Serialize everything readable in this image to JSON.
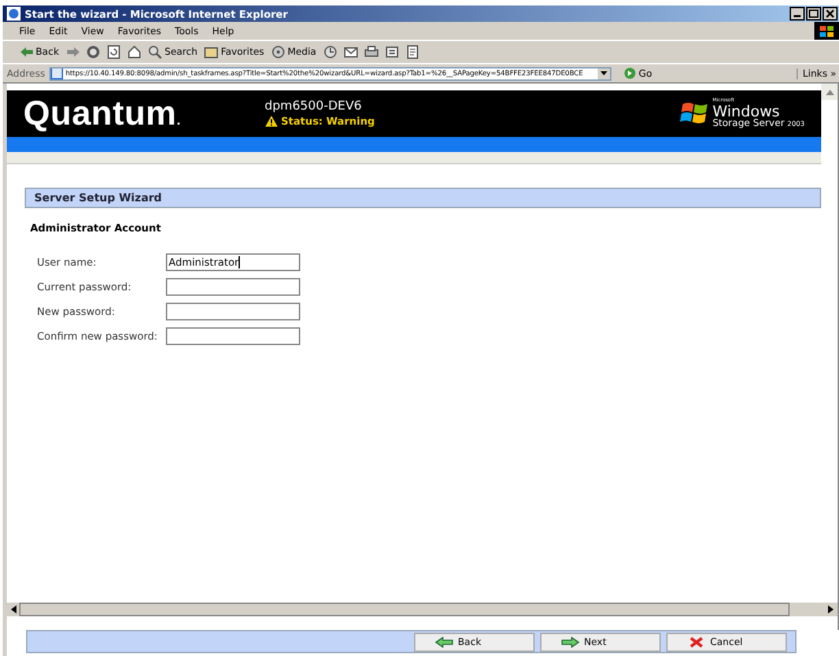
{
  "window": {
    "title": "Start the wizard - Microsoft Internet Explorer"
  },
  "menu": [
    "File",
    "Edit",
    "View",
    "Favorites",
    "Tools",
    "Help"
  ],
  "toolbar": [
    {
      "kind": "back",
      "label": "Back"
    },
    {
      "kind": "forward"
    },
    {
      "kind": "stop"
    },
    {
      "kind": "refresh"
    },
    {
      "kind": "home"
    },
    {
      "kind": "search",
      "label": "Search"
    },
    {
      "kind": "favorites",
      "label": "Favorites"
    },
    {
      "kind": "media",
      "label": "Media"
    },
    {
      "kind": "history"
    },
    {
      "kind": "mail"
    },
    {
      "kind": "print"
    },
    {
      "kind": "edit"
    },
    {
      "kind": "discuss"
    }
  ],
  "address_bar": {
    "label": "Address",
    "url": "https://10.40.149.80:8098/admin/sh_taskframes.asp?Title=Start%20the%20wizard&URL=wizard.asp?Tab1=%26__SAPageKey=54BFFE23FEE847DE0BCE",
    "go": "Go",
    "links": "Links »"
  },
  "header": {
    "brand": "Quantum",
    "brand_mark": ".",
    "device": "dpm6500-DEV6",
    "status": "Status: Warning",
    "os_vendor": "Microsoft",
    "os_name": "Windows",
    "os_edition": "Storage Server",
    "os_year": "2003"
  },
  "wizard": {
    "title": "Server Setup Wizard",
    "section": "Administrator Account",
    "fields": [
      {
        "label": "User name:",
        "value": "Administrator"
      },
      {
        "label": "Current password:"
      },
      {
        "label": "New password:"
      },
      {
        "label": "Confirm new password:"
      }
    ]
  },
  "buttons": [
    {
      "kind": "back",
      "label": "Back"
    },
    {
      "kind": "next",
      "label": "Next"
    },
    {
      "kind": "cancel",
      "label": "Cancel"
    }
  ]
}
